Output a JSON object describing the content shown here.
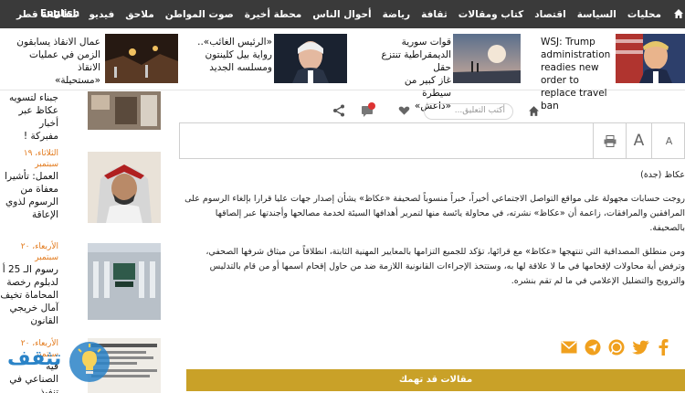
{
  "nav": {
    "items": [
      "محليات",
      "السياسة",
      "اقتصاد",
      "كتاب ومقالات",
      "ثقافة",
      "رياضة",
      "أحوال الناس",
      "محطة أخيرة",
      "صوت المواطن",
      "ملاحق",
      "فيديو",
      "مقاطعة قطر"
    ],
    "english": "English"
  },
  "headlines": [
    {
      "lines": [
        "WSJ: Trump",
        "administration",
        "readies new order to",
        "replace travel ban"
      ]
    },
    {
      "lines": [
        "قوات سورية",
        "الديمقراطية تنتزع حقل",
        "غاز كبير من سيطرة",
        "«داعش»"
      ]
    },
    {
      "lines": [
        "«الرئيس الغائب»..",
        "رواية بيل كلينتون",
        "ومسلسه الجديد"
      ]
    },
    {
      "lines": [
        "عمال الانقاذ يسابقون",
        "الزمن في عمليات الانقاذ",
        "«مستحيلة»"
      ]
    }
  ],
  "sidebar": {
    "items": [
      {
        "date": "",
        "lines": [
          "جبناء لتسويه",
          "عكاظ عبر أخبار",
          "مفبركة !"
        ]
      },
      {
        "date": "الثلاثاء، ١٩ سبتمبر",
        "lines": [
          "العمل: تأشيرا",
          "معفاة من",
          "الرسوم لذوي",
          "الإعاقة"
        ]
      },
      {
        "date": "الأربعاء، ٢٠ سبتمبر",
        "lines": [
          "رسوم الـ 25 أ",
          "لدبلوم رخصة",
          "المحاماة تخيف",
          "آمال خريجي",
          "القانون"
        ]
      },
      {
        "date": "الأربعاء، ٢٠ سبتمبر",
        "lines": [
          "فيه",
          "الصناعي في",
          "تنفيذ"
        ]
      }
    ],
    "logo_text": "تثقف"
  },
  "toolbar": {
    "comment_placeholder": "أكتب التعليق..."
  },
  "textbar": {
    "font_large": "A",
    "font_small": "A"
  },
  "article": {
    "byline": "عكاظ (جدة)",
    "paragraphs": [
      "روجت حسابات مجهولة على مواقع التواصل الاجتماعي أخيراً، خبراً منسوباً لصحيفة «عكاظ» يشأن إصدار جهات عليا قرارا بإلغاء الرسوم على المرافقين والمرافقات، زاعمة أن «عكاظ» نشرته، في محاولة يائسة منها لتمرير أهدافها السيئة لخدمة مصالحها وأجندتها عبر إلصاقها بالصحيفة.",
      "ومن منطلق المصداقية التي تنتهجها «عكاظ» مع قرائها، تؤكد للجميع التزامها بالمعايير المهنية الثابتة، انطلاقاً من ميثاق شرفها الصحفي، وترفض أية محاولات لإقحامها في ما لا علاقة لها به، وستتخذ الإجراءات القانونية اللازمة ضد من حاول إقحام اسمها أو من قام بالتدليس والترويج والتضليل الإعلامي في ما لم تقم بنشره."
    ]
  },
  "share": {
    "icons": [
      "facebook-icon",
      "twitter-icon",
      "whatsapp-icon",
      "telegram-icon",
      "email-icon"
    ]
  },
  "related": {
    "label": "مقالات قد تهمك"
  },
  "colors": {
    "nav_bg": "#3a3a3a",
    "accent": "#c9a128",
    "date": "#e2791b",
    "share_orange": "#f0a01e"
  }
}
